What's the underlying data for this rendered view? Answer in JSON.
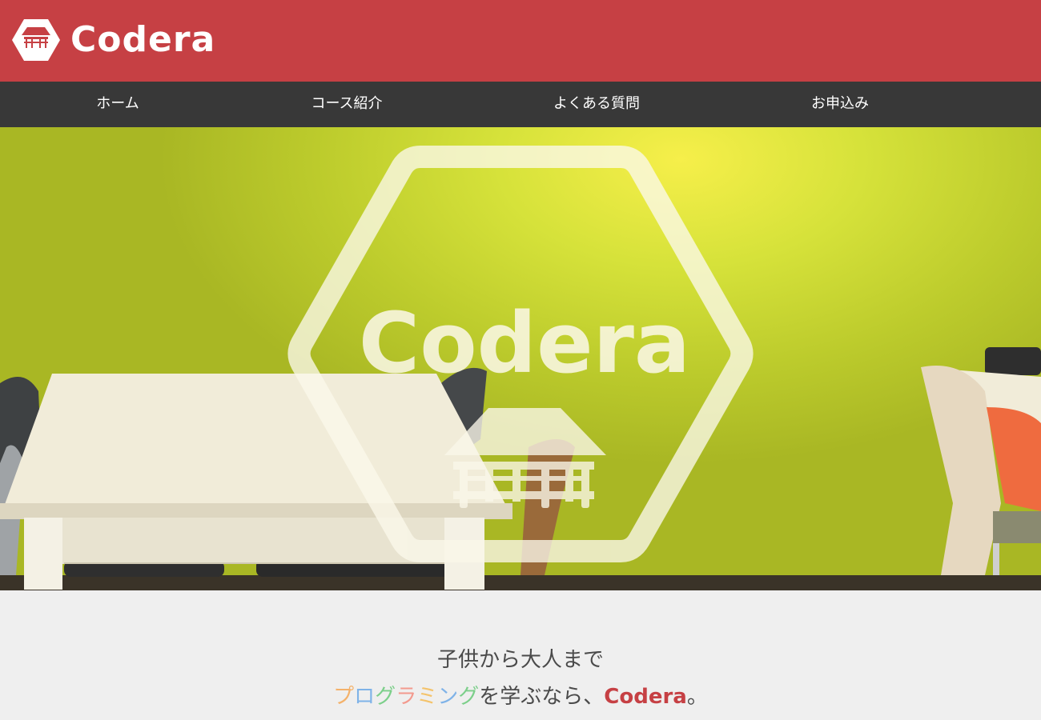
{
  "header": {
    "brand_name": "Codera",
    "colors": {
      "bar": "#c64044",
      "logo": "#ffffff"
    }
  },
  "nav": {
    "items": [
      {
        "label": "ホーム"
      },
      {
        "label": "コース紹介"
      },
      {
        "label": "よくある質問"
      },
      {
        "label": "お申込み"
      }
    ],
    "colors": {
      "bar": "#383838",
      "text": "#ffffff"
    }
  },
  "hero": {
    "overlay_logo_text": "Codera",
    "background_color": "#c9d832"
  },
  "tagline": {
    "line1": "子供から大人まで",
    "rainbow_word": [
      {
        "char": "プ",
        "color": "#f4b26b"
      },
      {
        "char": "ロ",
        "color": "#7fb3e8"
      },
      {
        "char": "グ",
        "color": "#7ccf8a"
      },
      {
        "char": "ラ",
        "color": "#f39a8e"
      },
      {
        "char": "ミ",
        "color": "#f4c36b"
      },
      {
        "char": "ン",
        "color": "#7fb3e8"
      },
      {
        "char": "グ",
        "color": "#7ccf8a"
      }
    ],
    "middle_text": "を学ぶなら、",
    "brand": "Codera",
    "end": "。",
    "brand_color": "#c64044"
  }
}
